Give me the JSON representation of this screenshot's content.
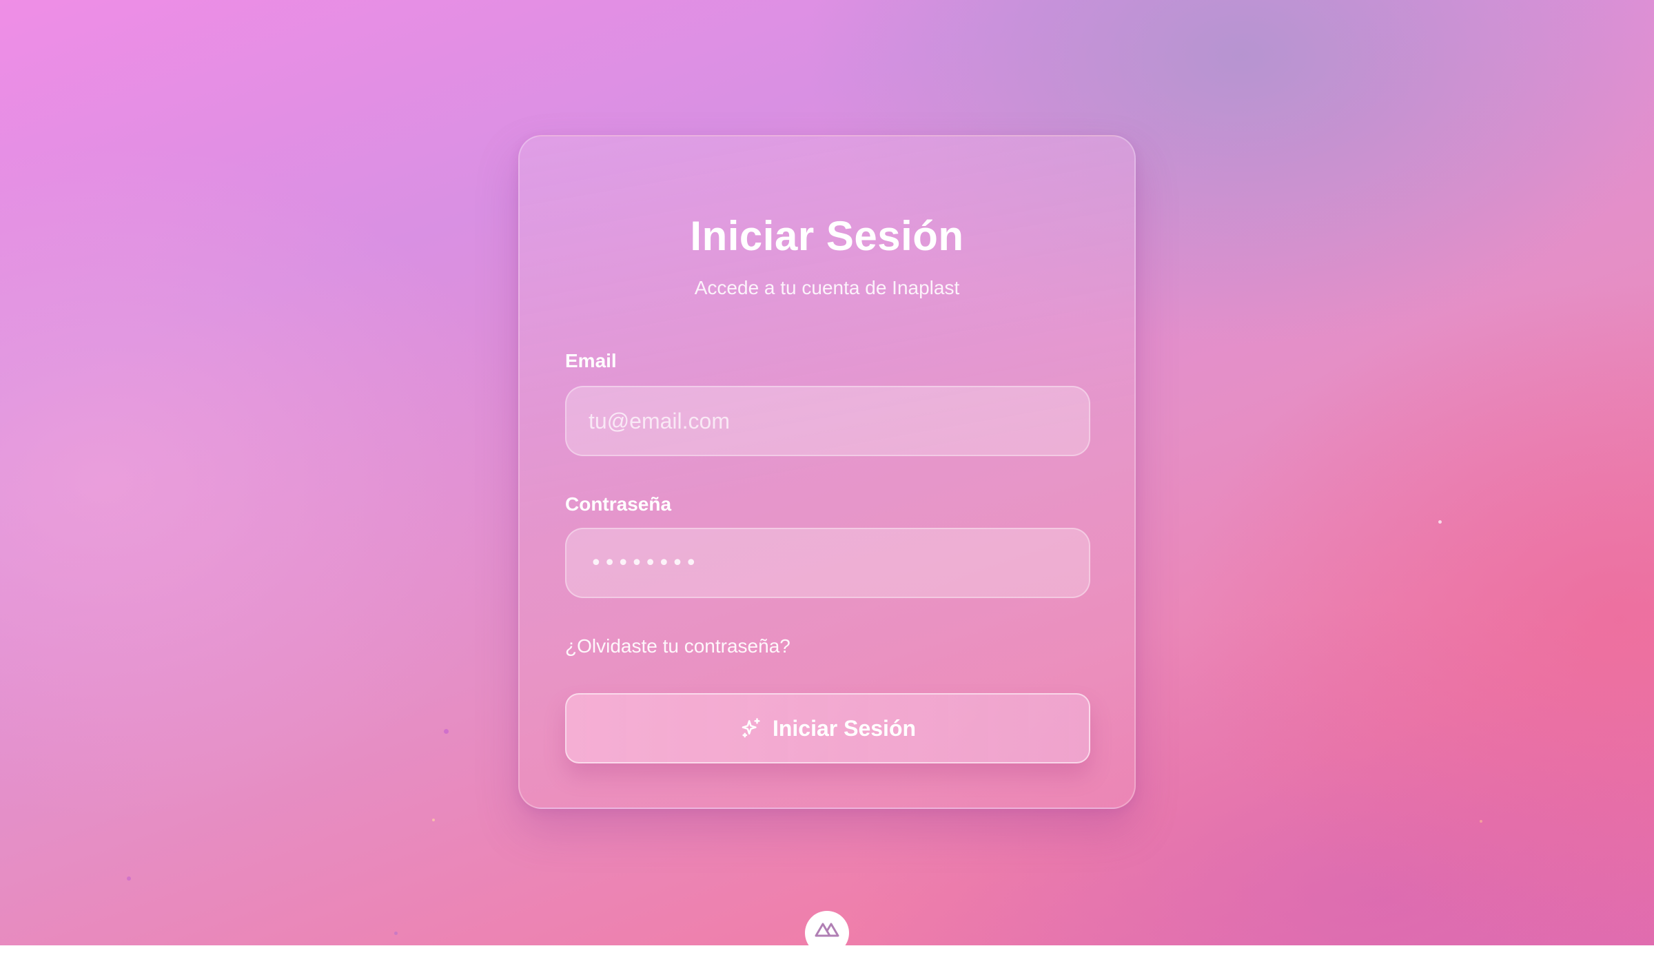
{
  "login": {
    "title": "Iniciar Sesión",
    "subtitle": "Accede a tu cuenta de Inaplast",
    "email_label": "Email",
    "email_placeholder": "tu@email.com",
    "password_label": "Contraseña",
    "password_mask": "••••••••",
    "forgot_link": "¿Olvidaste tu contraseña?",
    "submit_label": "Iniciar Sesión",
    "submit_icon": "sparkles-icon"
  },
  "footer": {
    "badge_icon": "nuxt-logo-icon"
  },
  "colors": {
    "background_start": "#ef8ee6",
    "background_end": "#e56fae",
    "text": "#ffffff"
  }
}
